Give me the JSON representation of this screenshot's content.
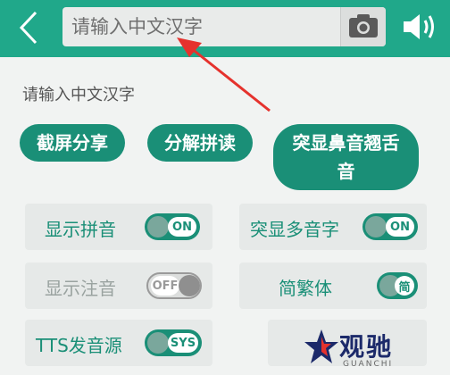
{
  "search": {
    "placeholder": "请输入中文汉字",
    "value": ""
  },
  "hint": "请输入中文汉字",
  "actions": {
    "screenshot_share": "截屏分享",
    "split_read": "分解拼读",
    "highlight_nasal_retroflex": "突显鼻音翘舌音"
  },
  "options": {
    "show_pinyin": {
      "label": "显示拼音",
      "toggle_text": "ON",
      "state": "on"
    },
    "highlight_polyphone": {
      "label": "突显多音字",
      "toggle_text": "ON",
      "state": "on"
    },
    "show_zhuyin": {
      "label": "显示注音",
      "toggle_text": "OFF",
      "state": "off"
    },
    "script_variant": {
      "label": "简繁体",
      "toggle_text": "简",
      "state": "on"
    },
    "tts_source": {
      "label": "TTS发音源",
      "toggle_text": "SYS",
      "state": "on"
    }
  },
  "watermark": {
    "text": "观驰",
    "subtext": "GUANCHI"
  },
  "colors": {
    "topbar": "#20a88a",
    "accent": "#1a8f77",
    "arrow": "#e5322d",
    "background": "#f1f3f2"
  },
  "icons": {
    "back": "chevron-left-icon",
    "camera": "camera-icon",
    "speaker": "speaker-icon"
  }
}
